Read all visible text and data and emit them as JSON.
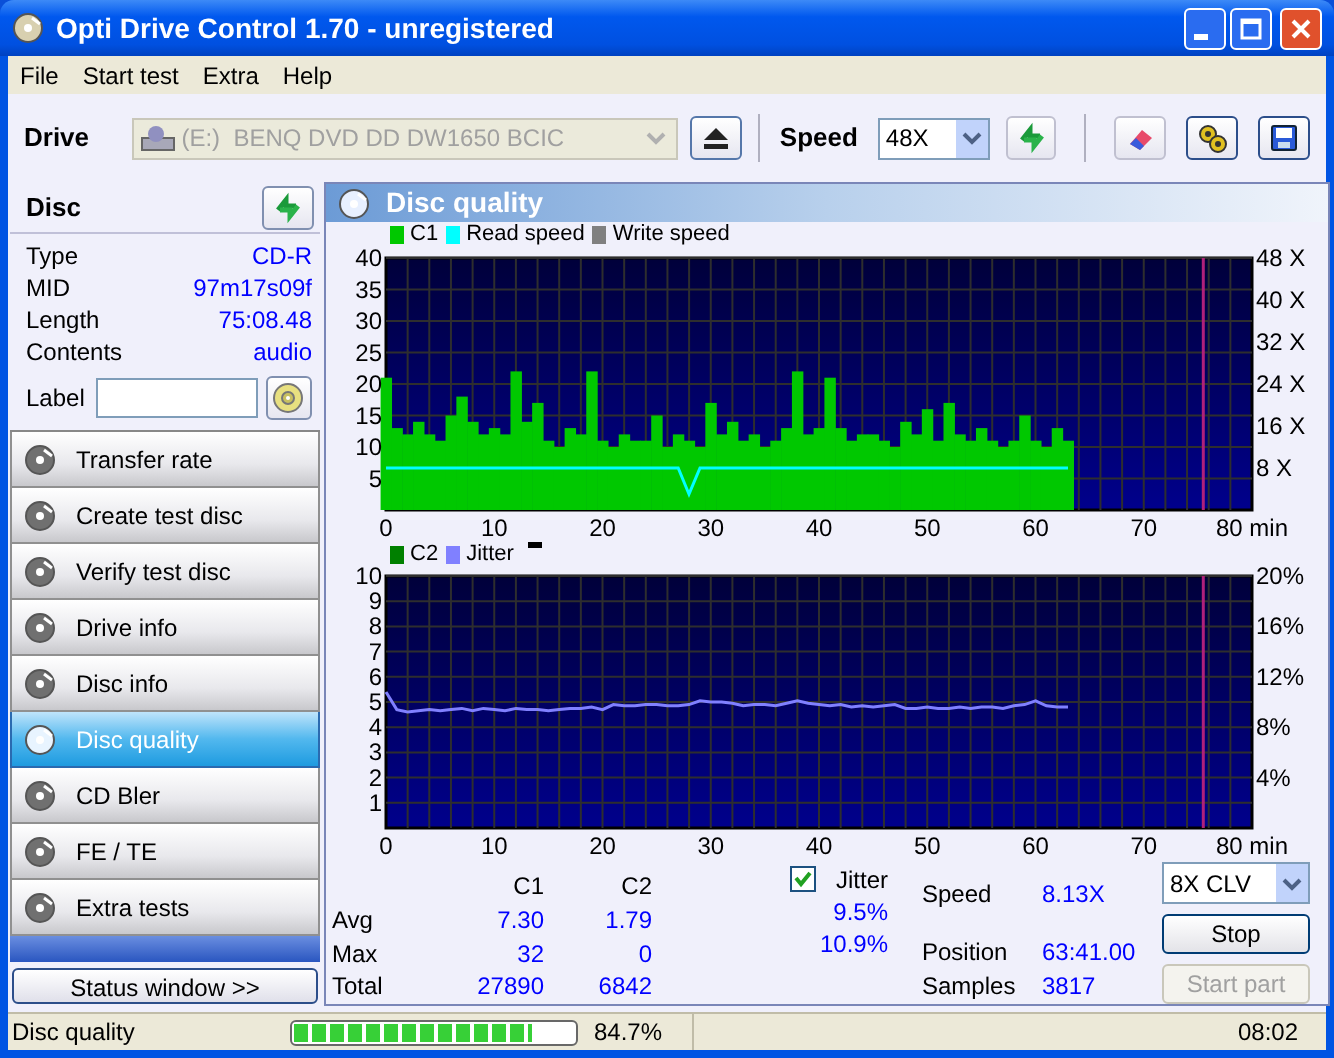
{
  "window": {
    "title": "Opti Drive Control 1.70 - unregistered"
  },
  "menu": [
    {
      "label": "File"
    },
    {
      "label": "Start test"
    },
    {
      "label": "Extra"
    },
    {
      "label": "Help"
    }
  ],
  "toolbar": {
    "drive_label": "Drive",
    "drive": {
      "value": "(E:)  BENQ DVD DD DW1650 BCIC",
      "disabled": true
    },
    "speed_label": "Speed",
    "speed": {
      "value": "48X"
    }
  },
  "disc": {
    "title": "Disc",
    "fields": [
      {
        "label": "Type",
        "value": "CD-R"
      },
      {
        "label": "MID",
        "value": "97m17s09f"
      },
      {
        "label": "Length",
        "value": "75:08.48"
      },
      {
        "label": "Contents",
        "value": "audio"
      }
    ],
    "label_field": {
      "label": "Label"
    }
  },
  "nav": [
    {
      "label": "Transfer rate",
      "selected": false
    },
    {
      "label": "Create test disc",
      "selected": false
    },
    {
      "label": "Verify test disc",
      "selected": false
    },
    {
      "label": "Drive info",
      "selected": false
    },
    {
      "label": "Disc info",
      "selected": false
    },
    {
      "label": "Disc quality",
      "selected": true
    },
    {
      "label": "CD Bler",
      "selected": false
    },
    {
      "label": "FE / TE",
      "selected": false
    },
    {
      "label": "Extra tests",
      "selected": false
    }
  ],
  "status_window_button": "Status window >>",
  "panel": {
    "title": "Disc quality",
    "chart1": {
      "legend_extra": [
        {
          "label": "Write speed",
          "color": "#808080"
        }
      ],
      "chart_data": {
        "type": "bar",
        "xlim": [
          0,
          80
        ],
        "ylim": [
          0,
          40
        ],
        "y2lim": [
          0,
          48
        ],
        "grid": true,
        "ref_lines": [
          {
            "axis": "x",
            "value": 75.5,
            "color": "#b0207a"
          }
        ],
        "xticks": [
          0,
          10,
          20,
          30,
          40,
          50,
          60,
          70,
          {
            "value": 80,
            "label": "80 min"
          }
        ],
        "yticks": [
          5,
          10,
          15,
          20,
          25,
          30,
          35,
          40
        ],
        "y2ticks": [
          {
            "value": 8,
            "label": "8 X"
          },
          {
            "value": 16,
            "label": "16 X"
          },
          {
            "value": 24,
            "label": "24 X"
          },
          {
            "value": 32,
            "label": "32 X"
          },
          {
            "value": 40,
            "label": "40 X"
          },
          {
            "value": 48,
            "label": "48 X"
          }
        ],
        "x": [
          0,
          1,
          2,
          3,
          4,
          5,
          6,
          7,
          8,
          9,
          10,
          11,
          12,
          13,
          14,
          15,
          16,
          17,
          18,
          19,
          20,
          21,
          22,
          23,
          24,
          25,
          26,
          27,
          28,
          29,
          30,
          31,
          32,
          33,
          34,
          35,
          36,
          37,
          38,
          39,
          40,
          41,
          42,
          43,
          44,
          45,
          46,
          47,
          48,
          49,
          50,
          51,
          52,
          53,
          54,
          55,
          56,
          57,
          58,
          59,
          60,
          61,
          62,
          63
        ],
        "series": [
          {
            "name": "C1",
            "color": "#00c800",
            "values": [
              21,
              13,
              12,
              14,
              12,
              11,
              15,
              18,
              14,
              12,
              13,
              12,
              22,
              14,
              17,
              11,
              10,
              13,
              12,
              22,
              11,
              10,
              12,
              11,
              11,
              15,
              10,
              12,
              11,
              10,
              17,
              12,
              14,
              11,
              12,
              10,
              11,
              13,
              22,
              12,
              13,
              21,
              13,
              11,
              12,
              12,
              11,
              10,
              14,
              12,
              16,
              11,
              17,
              12,
              11,
              13,
              11,
              10,
              11,
              15,
              11,
              10,
              13,
              11
            ]
          },
          {
            "name": "Read speed",
            "type": "line",
            "axis": "y2",
            "color": "#00ffff",
            "values": [
              8,
              8,
              8,
              8,
              8,
              8,
              8,
              8,
              8,
              8,
              8,
              8,
              8,
              8,
              8,
              8,
              8,
              8,
              8,
              8,
              8,
              8,
              8,
              8,
              8,
              8,
              8,
              8,
              3,
              8,
              8,
              8,
              8,
              8,
              8,
              8,
              8,
              8,
              8,
              8,
              8,
              8,
              8,
              8,
              8,
              8,
              8,
              8,
              8,
              8,
              8,
              8,
              8,
              8,
              8,
              8,
              8,
              8,
              8,
              8,
              8,
              8,
              8,
              8
            ]
          }
        ]
      }
    },
    "chart2": {
      "chart_data": {
        "type": "bar",
        "xlim": [
          0,
          80
        ],
        "ylim": [
          0,
          10
        ],
        "y2lim": [
          0,
          20
        ],
        "grid": true,
        "ref_lines": [
          {
            "axis": "x",
            "value": 75.5,
            "color": "#b0207a"
          }
        ],
        "xticks": [
          0,
          10,
          20,
          30,
          40,
          50,
          60,
          70,
          {
            "value": 80,
            "label": "80 min"
          }
        ],
        "yticks": [
          1,
          2,
          3,
          4,
          5,
          6,
          7,
          8,
          9,
          10
        ],
        "y2ticks": [
          {
            "value": 4,
            "label": "4%"
          },
          {
            "value": 8,
            "label": "8%"
          },
          {
            "value": 12,
            "label": "12%"
          },
          {
            "value": 16,
            "label": "16%"
          },
          {
            "value": 20,
            "label": "20%"
          }
        ],
        "x": [
          0,
          1,
          2,
          3,
          4,
          5,
          6,
          7,
          8,
          9,
          10,
          11,
          12,
          13,
          14,
          15,
          16,
          17,
          18,
          19,
          20,
          21,
          22,
          23,
          24,
          25,
          26,
          27,
          28,
          29,
          30,
          31,
          32,
          33,
          34,
          35,
          36,
          37,
          38,
          39,
          40,
          41,
          42,
          43,
          44,
          45,
          46,
          47,
          48,
          49,
          50,
          51,
          52,
          53,
          54,
          55,
          56,
          57,
          58,
          59,
          60,
          61,
          62,
          63
        ],
        "series": [
          {
            "name": "C2",
            "color": "#008000",
            "values": [
              0,
              0,
              0,
              0,
              0,
              0,
              0,
              0,
              0,
              0,
              0,
              0,
              0,
              0,
              0,
              0,
              0,
              0,
              0,
              0,
              0,
              0,
              0,
              0,
              0,
              0,
              0,
              0,
              0,
              0,
              0,
              0,
              0,
              0,
              0,
              0,
              0,
              0,
              0,
              0,
              0,
              0,
              0,
              0,
              0,
              0,
              0,
              0,
              0,
              0,
              0,
              0,
              0,
              0,
              0,
              0,
              0,
              0,
              0,
              0,
              0,
              0,
              0,
              0
            ]
          },
          {
            "name": "Jitter",
            "type": "line",
            "axis": "y2",
            "color": "#8080ff",
            "values": [
              10.8,
              9.4,
              9.2,
              9.3,
              9.4,
              9.3,
              9.4,
              9.5,
              9.3,
              9.5,
              9.4,
              9.3,
              9.5,
              9.4,
              9.4,
              9.3,
              9.4,
              9.5,
              9.5,
              9.6,
              9.4,
              9.8,
              9.7,
              9.7,
              9.8,
              9.8,
              9.7,
              9.7,
              9.8,
              10.1,
              10.0,
              10.0,
              9.9,
              9.7,
              9.8,
              9.8,
              9.7,
              9.9,
              10.1,
              9.9,
              9.8,
              9.7,
              9.8,
              9.6,
              9.7,
              9.6,
              9.7,
              9.8,
              9.5,
              9.5,
              9.6,
              9.5,
              9.5,
              9.6,
              9.5,
              9.6,
              9.6,
              9.5,
              9.7,
              9.8,
              10.1,
              9.7,
              9.6,
              9.6
            ]
          }
        ]
      }
    },
    "stats": {
      "columns": [
        "C1",
        "C2"
      ],
      "rows": [
        {
          "label": "Avg",
          "c1": "7.30",
          "c2": "1.79",
          "jitter": "9.5%"
        },
        {
          "label": "Max",
          "c1": "32",
          "c2": "0",
          "jitter": "10.9%"
        },
        {
          "label": "Total",
          "c1": "27890",
          "c2": "6842"
        }
      ],
      "jitter_checkbox": {
        "label": "Jitter",
        "checked": true
      },
      "info": [
        {
          "label": "Speed",
          "value": "8.13X"
        },
        {
          "label": "Position",
          "value": "63:41.00"
        },
        {
          "label": "Samples",
          "value": "3817"
        }
      ],
      "mode": {
        "value": "8X CLV"
      },
      "buttons": [
        {
          "label": "Stop",
          "disabled": false
        },
        {
          "label": "Start part",
          "disabled": true
        }
      ]
    }
  },
  "status_bar": {
    "text": "Disc quality",
    "progress": {
      "level": 0.847
    },
    "percent": "84.7%",
    "time": "08:02"
  }
}
